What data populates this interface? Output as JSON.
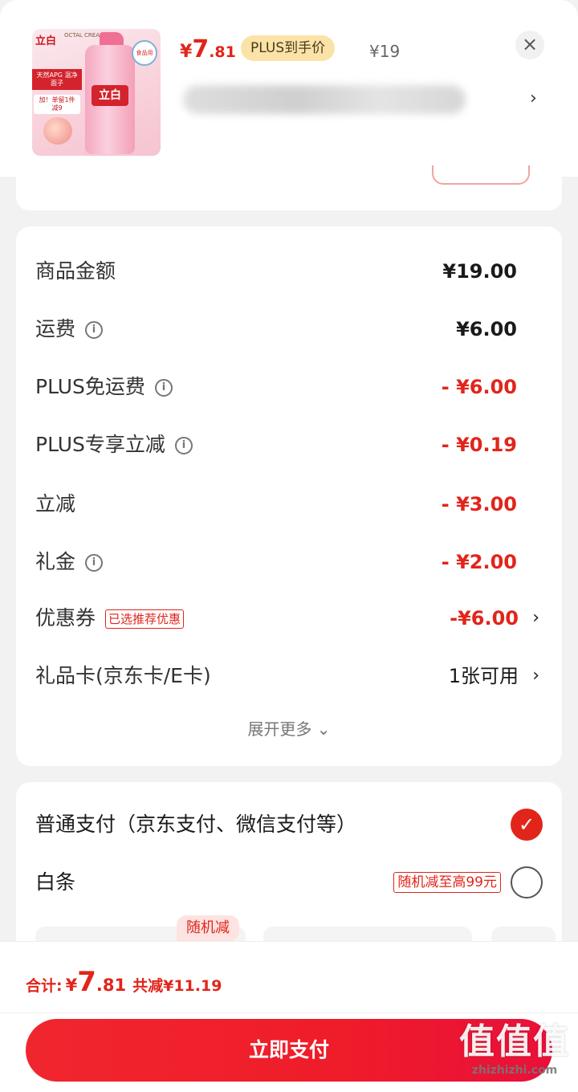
{
  "product": {
    "price_currency": "¥",
    "price_integer": "7",
    "price_decimal": ".81",
    "plus_tag": "PLUS到手价",
    "original_price": "¥19",
    "thumbnail": {
      "brand": "立白",
      "brand_sub": "OCTAL CREAM",
      "ribbon": "天然APG 温净面子",
      "ribbon2": "加！单留1件 减9",
      "label": "立白",
      "badge": "食品用"
    },
    "close_icon": "close-icon",
    "spec_arrow_icon": "chevron-right-icon"
  },
  "breakdown": {
    "rows": [
      {
        "label": "商品金额",
        "value": "¥19.00",
        "red": false,
        "info": false
      },
      {
        "label": "运费",
        "value": "¥6.00",
        "red": false,
        "info": true
      },
      {
        "label": "PLUS免运费",
        "value": "- ¥6.00",
        "red": true,
        "info": true
      },
      {
        "label": "PLUS专享立减",
        "value": "- ¥0.19",
        "red": true,
        "info": true
      },
      {
        "label": "立减",
        "value": "- ¥3.00",
        "red": true,
        "info": false
      },
      {
        "label": "礼金",
        "value": "- ¥2.00",
        "red": true,
        "info": true
      }
    ],
    "coupon": {
      "label": "优惠券",
      "tag": "已选推荐优惠",
      "value": "-¥6.00"
    },
    "giftcard": {
      "label": "礼品卡(京东卡/E卡)",
      "value": "1张可用"
    },
    "expand": "展开更多 ⌄",
    "info_glyph": "i",
    "chevron": "›"
  },
  "payment": {
    "normal": {
      "label": "普通支付（京东支付、微信支付等）",
      "selected": true,
      "check": "✓"
    },
    "baitiao": {
      "label": "白条",
      "tag": "随机减至高99元",
      "selected": false
    },
    "random_tag": "随机减"
  },
  "footer": {
    "total_label": "合计:",
    "total_currency": "¥",
    "total_integer": "7",
    "total_decimal": ".81",
    "saved": "共减¥11.19",
    "pay_button": "立即支付"
  },
  "watermark": {
    "big": "值值值",
    "small": "zhizhizhi.com"
  },
  "colors": {
    "accent": "#e1251b",
    "plus_tag_bg": "#fbe3a8"
  }
}
